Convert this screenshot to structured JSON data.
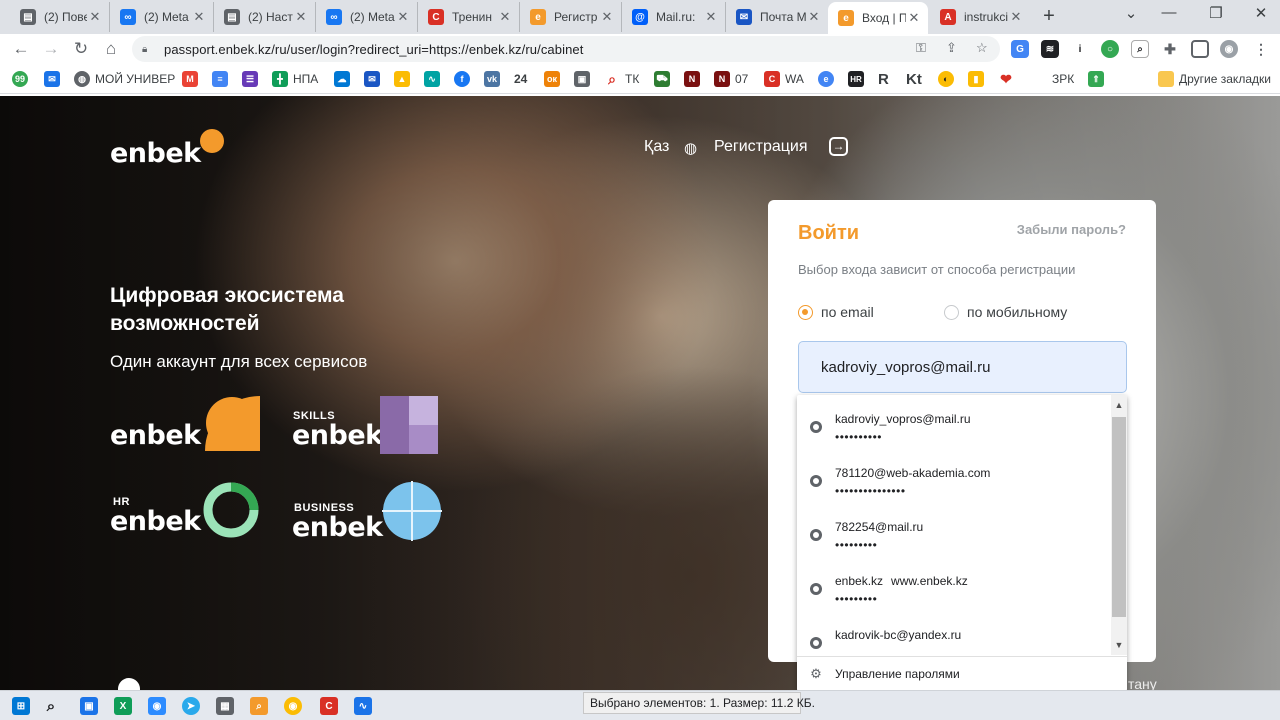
{
  "tabs": [
    {
      "title": "(2) Пове",
      "icon": "document-icon",
      "color": "#5f6368"
    },
    {
      "title": "(2) Meta",
      "icon": "meta-icon",
      "color": "#1877f2"
    },
    {
      "title": "(2) Наст",
      "icon": "document-icon",
      "color": "#5f6368"
    },
    {
      "title": "(2) Meta",
      "icon": "meta-icon",
      "color": "#1877f2"
    },
    {
      "title": "Тренин",
      "icon": "c-logo-icon",
      "color": "#d93025"
    },
    {
      "title": "Регистр",
      "icon": "enbek-icon",
      "color": "#f39a2c"
    },
    {
      "title": "Mail.ru:",
      "icon": "at-icon",
      "color": "#005ff9"
    },
    {
      "title": "Почта М",
      "icon": "mail-icon",
      "color": "#1a56c4"
    },
    {
      "title": "Вход | П",
      "icon": "enbek-icon",
      "color": "#f39a2c"
    },
    {
      "title": "instrukci",
      "icon": "pdf-icon",
      "color": "#d93025"
    }
  ],
  "address_bar": {
    "url": "passport.enbek.kz/ru/user/login?redirect_uri=https://enbek.kz/ru/cabinet"
  },
  "bookmarks": {
    "items": [
      {
        "label": "МОЙ УНИВЕР"
      },
      {
        "label": "НПА"
      },
      {
        "label": "ТК"
      },
      {
        "label": "24"
      },
      {
        "label": "07"
      },
      {
        "label": "WA"
      },
      {
        "label": "HR"
      },
      {
        "label": "R"
      },
      {
        "label": "Kt"
      },
      {
        "label": "ЗРК"
      }
    ],
    "other": "Другие закладки"
  },
  "site": {
    "logo": "enbek",
    "lang": "Қаз",
    "register": "Регистрация",
    "headline": "Цифровая экосистема возможностей",
    "subline": "Один аккаунт для всех сервисов",
    "services": [
      {
        "tag": "",
        "name": "enbek"
      },
      {
        "tag": "SKILLS",
        "name": "enbek"
      },
      {
        "tag": "HR",
        "name": "enbek"
      },
      {
        "tag": "BUSINESS",
        "name": "enbek"
      }
    ],
    "footer_tail": "тану"
  },
  "login": {
    "title": "Войти",
    "forgot": "Забыли пароль?",
    "hint": "Выбор входа зависит от способа регистрации",
    "radio_email": "по email",
    "radio_mobile": "по мобильному",
    "email_value": "kadroviy_vopros@mail.ru",
    "selected_method": "email"
  },
  "autofill": {
    "items": [
      {
        "user": "kadroviy_vopros@mail.ru",
        "site": "",
        "password": "••••••••••"
      },
      {
        "user": "781120@web-akademia.com",
        "site": "",
        "password": "•••••••••••••••"
      },
      {
        "user": "782254@mail.ru",
        "site": "",
        "password": "•••••••••"
      },
      {
        "user": "enbek.kz",
        "site": "www.enbek.kz",
        "password": "•••••••••"
      },
      {
        "user": "kadrovik-bc@yandex.ru",
        "site": "",
        "password": ""
      }
    ],
    "manage": "Управление паролями"
  },
  "status_bar": "Выбрано элементов: 1. Размер: 11.2 КБ.",
  "colors": {
    "accent": "#f39a2c",
    "input_bg": "#e8f0fe"
  }
}
